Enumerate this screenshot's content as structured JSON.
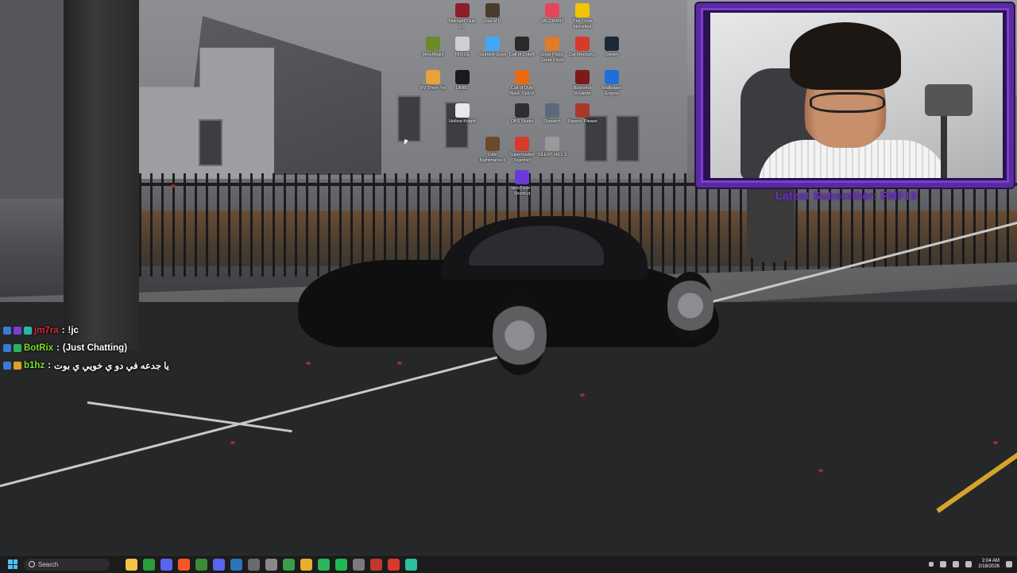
{
  "desktop": {
    "icons": [
      {
        "label": "Midnight Club: L...",
        "icon": "midnight-club-icon",
        "color": "#8a1e2a"
      },
      {
        "label": "Lies of P",
        "icon": "lies-of-p-icon",
        "color": "#4a3b2c"
      },
      {
        "label": "VALORANT",
        "icon": "valorant-icon",
        "color": "#e4475a"
      },
      {
        "label": "The Crew Motorfest",
        "icon": "the-crew-icon",
        "color": "#f2c300"
      },
      {
        "label": "MineMogul",
        "icon": "minemogul-icon",
        "color": "#6b8a2a"
      },
      {
        "label": "INSIDE",
        "icon": "inside-icon",
        "color": "#d0d0d0"
      },
      {
        "label": "Stumble Guys",
        "icon": "stumble-guys-icon",
        "color": "#3fa9f5"
      },
      {
        "label": "Call of Duty®",
        "icon": "call-of-duty-icon",
        "color": "#2a2a2a"
      },
      {
        "label": "Good Pizza, Great Pizza",
        "icon": "good-pizza-icon",
        "color": "#e07b2a"
      },
      {
        "label": "Car Mechan...",
        "icon": "car-mechanic-icon",
        "color": "#d73a2a"
      },
      {
        "label": "Steam",
        "icon": "steam-icon",
        "color": "#1b2838"
      },
      {
        "label": "RV There Yet",
        "icon": "rv-there-yet-icon",
        "color": "#e9a23b"
      },
      {
        "label": "LIMBO",
        "icon": "limbo-icon",
        "color": "#1a1a1a"
      },
      {
        "label": "Call of Duty Black Ops III",
        "icon": "black-ops-icon",
        "color": "#e86a10"
      },
      {
        "label": "Buckshot Roulette",
        "icon": "buckshot-icon",
        "color": "#7a1a1a"
      },
      {
        "label": "Wallpaper Engine",
        "icon": "wallpaper-engine-icon",
        "color": "#1e6fd9"
      },
      {
        "label": "Hollow Knight",
        "icon": "hollow-knight-icon",
        "color": "#e8e8e8"
      },
      {
        "label": "OBS Studio",
        "icon": "obs-icon",
        "color": "#302e31"
      },
      {
        "label": "Dispatch",
        "icon": "dispatch-icon",
        "color": "#5a6a7a"
      },
      {
        "label": "Papers, Please",
        "icon": "papers-please-icon",
        "color": "#a83a2a"
      },
      {
        "label": "Little Nightmares II",
        "icon": "little-nightmares-icon",
        "color": "#6a4a2a"
      },
      {
        "label": "Supermarket Together",
        "icon": "supermarket-icon",
        "color": "#d93a2a"
      },
      {
        "label": "SILENT HILL 2",
        "icon": "silent-hill-icon",
        "color": "#9a9a9a"
      },
      {
        "label": "rpcs3.exe - Shortcut",
        "icon": "rpcs3-icon",
        "color": "#6a3ad9"
      }
    ]
  },
  "webcam": {
    "latest_subscriber": "Latest Subscriber: FMF15"
  },
  "chat": {
    "messages": [
      {
        "user": "jm7ra",
        "sep": ":",
        "text": "!jc",
        "user_color": "#e0243a",
        "badge_colors": [
          "#3a7bd5",
          "#7a3fd0",
          "#2ab6a0"
        ]
      },
      {
        "user": "BotRix",
        "sep": ":",
        "text": "(Just Chatting)",
        "user_color": "#7ddf2a",
        "badge_colors": [
          "#3a7bd5",
          "#2ab65a"
        ]
      },
      {
        "user": "b1hz",
        "sep": ":",
        "text": "يا جدعه في دو ي خويي ي بوت",
        "user_color": "#7ddf2a",
        "badge_colors": [
          "#3a7bd5",
          "#e0a020"
        ]
      }
    ]
  },
  "taskbar": {
    "search_placeholder": "Search",
    "apps": [
      {
        "icon": "file-explorer-icon",
        "color": "#f4c542"
      },
      {
        "icon": "xbox-icon",
        "color": "#2a9d3a"
      },
      {
        "icon": "discord-icon",
        "color": "#5865f2"
      },
      {
        "icon": "brave-icon",
        "color": "#fb542b"
      },
      {
        "icon": "chat-app-icon",
        "color": "#3a8a3a"
      },
      {
        "icon": "discord-alt-icon",
        "color": "#5865f2"
      },
      {
        "icon": "steam-taskbar-icon",
        "color": "#2a75bb"
      },
      {
        "icon": "game-app-icon",
        "color": "#6a6a6a"
      },
      {
        "icon": "settings-app-icon",
        "color": "#888888"
      },
      {
        "icon": "chrome-icon",
        "color": "#3a9d4a"
      },
      {
        "icon": "notes-app-icon",
        "color": "#e8b02a"
      },
      {
        "icon": "xbox-bar-icon",
        "color": "#2ab65a"
      },
      {
        "icon": "spotify-icon",
        "color": "#1db954"
      },
      {
        "icon": "tool-app-icon",
        "color": "#7a7a7a"
      },
      {
        "icon": "terminal-app-icon",
        "color": "#c0392b"
      },
      {
        "icon": "capcut-icon",
        "color": "#d93a2a"
      },
      {
        "icon": "stream-app-icon",
        "color": "#2ac0a0"
      }
    ],
    "clock_time": "2:04 AM",
    "clock_date": "2/18/2026"
  }
}
